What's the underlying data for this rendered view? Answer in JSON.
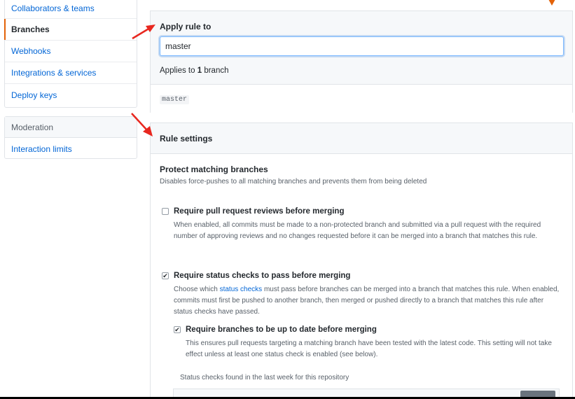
{
  "sidebar": {
    "items": [
      {
        "label": "Collaborators & teams"
      },
      {
        "label": "Branches"
      },
      {
        "label": "Webhooks"
      },
      {
        "label": "Integrations & services"
      },
      {
        "label": "Deploy keys"
      }
    ],
    "moderation": {
      "header": "Moderation",
      "items": [
        {
          "label": "Interaction limits"
        }
      ]
    }
  },
  "apply_rule": {
    "title": "Apply rule to",
    "input_value": "master",
    "applies_prefix": "Applies to",
    "applies_count": "1",
    "applies_suffix": "branch",
    "branches": [
      "master"
    ]
  },
  "rule_settings": {
    "title": "Rule settings",
    "protect_title": "Protect matching branches",
    "protect_desc": "Disables force-pushes to all matching branches and prevents them from being deleted",
    "options": [
      {
        "label": "Require pull request reviews before merging",
        "checked": false,
        "desc": "When enabled, all commits must be made to a non-protected branch and submitted via a pull request with the required number of approving reviews and no changes requested before it can be merged into a branch that matches this rule."
      },
      {
        "label": "Require status checks to pass before merging",
        "checked": true,
        "desc_before_link": "Choose which ",
        "desc_link": "status checks",
        "desc_after_link": " must pass before branches can be merged into a branch that matches this rule. When enabled, commits must first be pushed to another branch, then merged or pushed directly to a branch that matches this rule after status checks have passed."
      },
      {
        "label": "Require branches to be up to date before merging",
        "checked": true,
        "desc": "This ensures pull requests targeting a matching branch have been tested with the latest code. This setting will not take effect unless at least one status check is enabled (see below)."
      }
    ],
    "status_checks_found": "Status checks found in the last week for this repository"
  },
  "colors": {
    "link": "#0366d6",
    "selected_accent": "#e36209",
    "annotation_arrow": "#e8271f"
  }
}
